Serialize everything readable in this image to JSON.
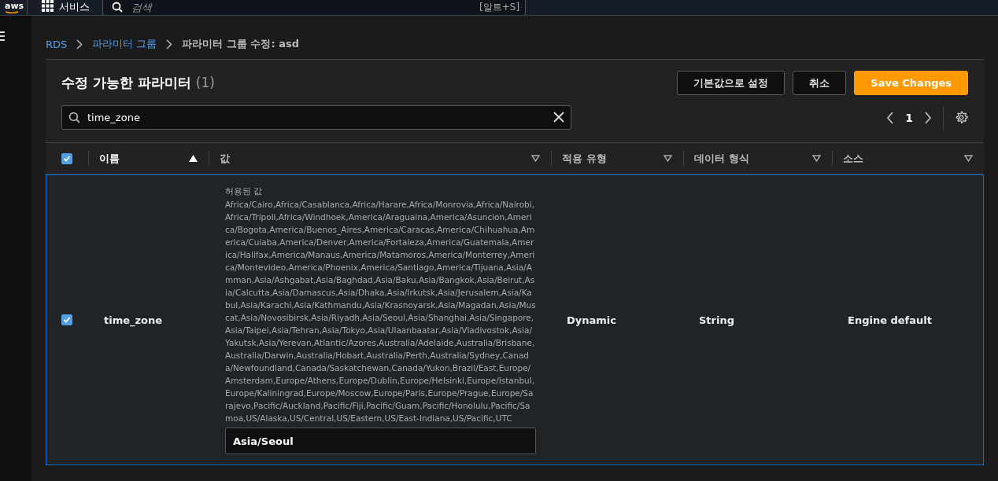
{
  "top_bar": {
    "logo": "aws",
    "services": "서비스",
    "search": {
      "placeholder": "검색",
      "shortcut": "[알트+S]"
    }
  },
  "breadcrumb": [
    {
      "label": "RDS",
      "link": true
    },
    {
      "label": "파라미터 그룹",
      "link": true
    },
    {
      "label": "파라미터 그룹 수정: asd",
      "link": false
    }
  ],
  "panel": {
    "title": "수정 가능한 파라미터",
    "count": "(1)",
    "buttons": [
      {
        "label": "기본값으로 설정",
        "kind": "normal"
      },
      {
        "label": "취소",
        "kind": "normal"
      },
      {
        "label": "Save Changes",
        "kind": "primary"
      }
    ],
    "filter": {
      "value": "time_zone"
    },
    "page": "1"
  },
  "table": {
    "select_all_checked": true,
    "columns": [
      {
        "label": "이름",
        "sorted": true
      },
      {
        "label": "값",
        "sorted": false
      },
      {
        "label": "적용 유형",
        "sorted": false
      },
      {
        "label": "데이터 형식",
        "sorted": false
      },
      {
        "label": "소스",
        "sorted": false
      }
    ],
    "rows": [
      {
        "checked": true,
        "selected": true,
        "name": "time_zone",
        "allowed_label": "허용된 값",
        "allowed_values": "Africa/Cairo,Africa/Casablanca,Africa/Harare,Africa/Monrovia,Africa/Nairobi,Africa/Tripoli,Africa/Windhoek,America/Araguaina,America/Asuncion,America/Bogota,America/Buenos_Aires,America/Caracas,America/Chihuahua,America/Cuiaba,America/Denver,America/Fortaleza,America/Guatemala,America/Halifax,America/Manaus,America/Matamoros,America/Monterrey,America/Montevideo,America/Phoenix,America/Santiago,America/Tijuana,Asia/Amman,Asia/Ashgabat,Asia/Baghdad,Asia/Baku,Asia/Bangkok,Asia/Beirut,Asia/Calcutta,Asia/Damascus,Asia/Dhaka,Asia/Irkutsk,Asia/Jerusalem,Asia/Kabul,Asia/Karachi,Asia/Kathmandu,Asia/Krasnoyarsk,Asia/Magadan,Asia/Muscat,Asia/Novosibirsk,Asia/Riyadh,Asia/Seoul,Asia/Shanghai,Asia/Singapore,Asia/Taipei,Asia/Tehran,Asia/Tokyo,Asia/Ulaanbaatar,Asia/Vladivostok,Asia/Yakutsk,Asia/Yerevan,Atlantic/Azores,Australia/Adelaide,Australia/Brisbane,Australia/Darwin,Australia/Hobart,Australia/Perth,Australia/Sydney,Canada/Newfoundland,Canada/Saskatchewan,Canada/Yukon,Brazil/East,Europe/Amsterdam,Europe/Athens,Europe/Dublin,Europe/Helsinki,Europe/Istanbul,Europe/Kaliningrad,Europe/Moscow,Europe/Paris,Europe/Prague,Europe/Sarajevo,Pacific/Auckland,Pacific/Fiji,Pacific/Guam,Pacific/Honolulu,Pacific/Samoa,US/Alaska,US/Central,US/Eastern,US/East-Indiana,US/Pacific,UTC",
        "value": "Asia/Seoul",
        "apply_type": "Dynamic",
        "data_type": "String",
        "source": "Engine default"
      }
    ]
  }
}
